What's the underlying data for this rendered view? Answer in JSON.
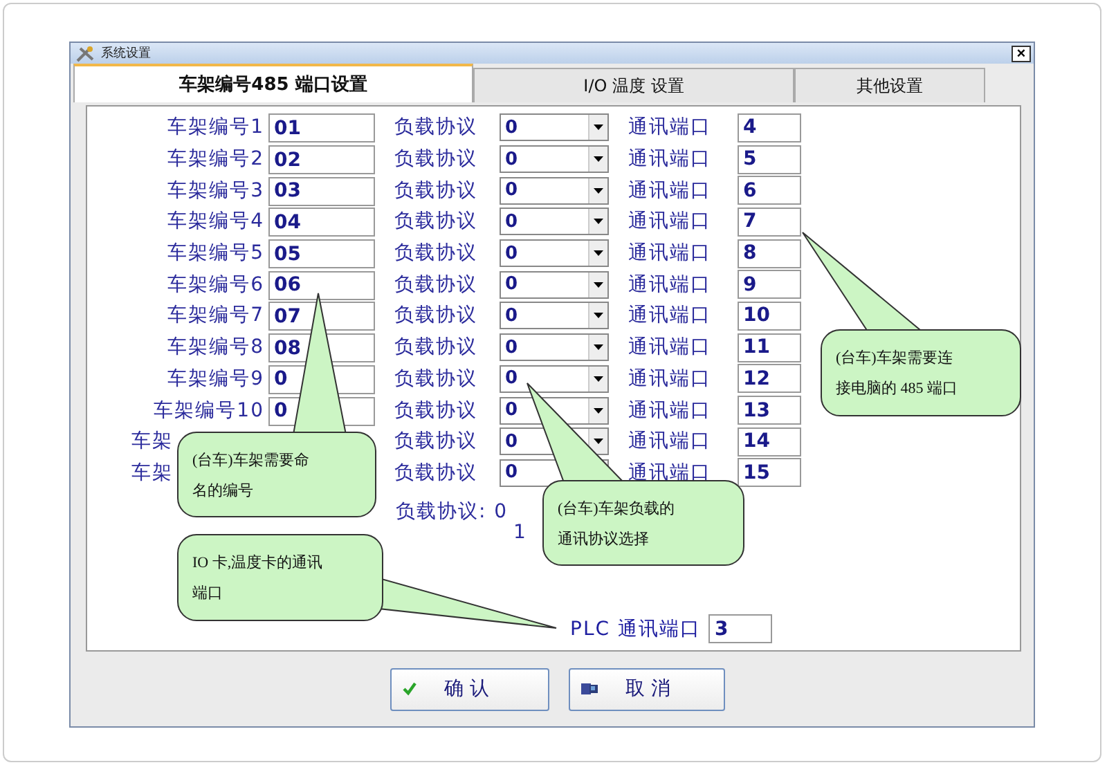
{
  "window": {
    "title": "系统设置",
    "close": "×"
  },
  "tabs": [
    {
      "label": "车架编号485 端口设置",
      "selected": true
    },
    {
      "label": "I/O 温度 设置",
      "selected": false
    },
    {
      "label": "其他设置",
      "selected": false
    }
  ],
  "rows": [
    {
      "frame_label": "车架编号1",
      "frame_number": "01",
      "protocol_label": "负载协议",
      "protocol": "0",
      "port_label": "通讯端口",
      "port": "4"
    },
    {
      "frame_label": "车架编号2",
      "frame_number": "02",
      "protocol_label": "负载协议",
      "protocol": "0",
      "port_label": "通讯端口",
      "port": "5"
    },
    {
      "frame_label": "车架编号3",
      "frame_number": "03",
      "protocol_label": "负载协议",
      "protocol": "0",
      "port_label": "通讯端口",
      "port": "6"
    },
    {
      "frame_label": "车架编号4",
      "frame_number": "04",
      "protocol_label": "负载协议",
      "protocol": "0",
      "port_label": "通讯端口",
      "port": "7"
    },
    {
      "frame_label": "车架编号5",
      "frame_number": "05",
      "protocol_label": "负载协议",
      "protocol": "0",
      "port_label": "通讯端口",
      "port": "8"
    },
    {
      "frame_label": "车架编号6",
      "frame_number": "06",
      "protocol_label": "负载协议",
      "protocol": "0",
      "port_label": "通讯端口",
      "port": "9"
    },
    {
      "frame_label": "车架编号7",
      "frame_number": "07",
      "protocol_label": "负载协议",
      "protocol": "0",
      "port_label": "通讯端口",
      "port": "10"
    },
    {
      "frame_label": "车架编号8",
      "frame_number": "08",
      "protocol_label": "负载协议",
      "protocol": "0",
      "port_label": "通讯端口",
      "port": "11"
    },
    {
      "frame_label": "车架编号9",
      "frame_number": "0",
      "protocol_label": "负载协议",
      "protocol": "0",
      "port_label": "通讯端口",
      "port": "12"
    },
    {
      "frame_label": "车架编号10",
      "frame_number": "0",
      "protocol_label": "负载协议",
      "protocol": "0",
      "port_label": "通讯端口",
      "port": "13"
    },
    {
      "frame_label": "车架",
      "protocol_label": "负载协议",
      "protocol": "0",
      "port_label": "通讯端口",
      "port": "14"
    },
    {
      "frame_label": "车架",
      "protocol_label": "负载协议",
      "protocol": "0",
      "port_label": "通讯端口",
      "port": "15"
    }
  ],
  "protocol_note": [
    "负载协议: 0",
    "1"
  ],
  "plc": {
    "label": "PLC 通讯端口",
    "value": "3"
  },
  "buttons": [
    {
      "label": "确 认",
      "kind": "ok"
    },
    {
      "label": "取 消",
      "kind": "cancel"
    }
  ],
  "callouts": [
    {
      "lines": [
        "(台车)车架需要命",
        "名的编号"
      ]
    },
    {
      "lines": [
        "(台车)车架负载的",
        "通讯协议选择"
      ]
    },
    {
      "lines": [
        "(台车)车架需要连",
        "接电脑的 485 端口"
      ]
    },
    {
      "lines": [
        "IO 卡,温度卡的通讯",
        "端口"
      ]
    }
  ]
}
